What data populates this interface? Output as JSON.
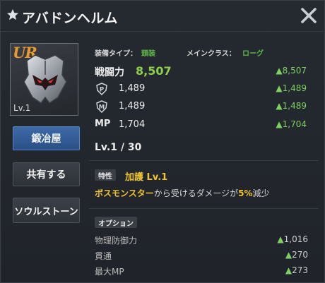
{
  "title": "アバドンヘルム",
  "item": {
    "rarity": "UR",
    "level": "Lv.1"
  },
  "buttons": {
    "smith": "鍛冶屋",
    "share": "共有する",
    "soulstone": "ソウルストーン"
  },
  "info": {
    "type_label": "装備タイプ：",
    "type_value": "頭装",
    "class_label": "メインクラス：",
    "class_value": "ローグ"
  },
  "stats": {
    "power_label": "戦闘力",
    "power_value": "8,507",
    "power_diff": "▲8,507",
    "p_value": "1,489",
    "p_diff": "▲1,489",
    "m_value": "1,489",
    "m_diff": "▲1,489",
    "mp_label": "MP",
    "mp_value": "1,704",
    "mp_diff": "▲1,704"
  },
  "level_line": "Lv.1 / 30",
  "trait": {
    "tag": "特性",
    "name": "加護 Lv.1",
    "desc_part1": "ボスモンスター",
    "desc_part2": "から受けるダメージが",
    "desc_part3": "5%",
    "desc_part4": "減少"
  },
  "options": {
    "tag": "オプション",
    "items": [
      {
        "label": "物理防御力",
        "arrow": "▲",
        "value": "1,016"
      },
      {
        "label": "貫通",
        "arrow": "▲",
        "value": "270"
      },
      {
        "label": "最大MP",
        "arrow": "▲",
        "value": "273"
      }
    ]
  },
  "colors": {
    "accent_green": "#8fd04a",
    "diff_green": "#7fd060",
    "trait_yellow": "#f0c330",
    "rarity_orange": "#e89a2e",
    "button_blue": "#3e6aa8"
  },
  "icons": {
    "title": "star-icon",
    "close": "close-icon",
    "p": "physical-defense-icon",
    "m": "magic-defense-icon"
  }
}
